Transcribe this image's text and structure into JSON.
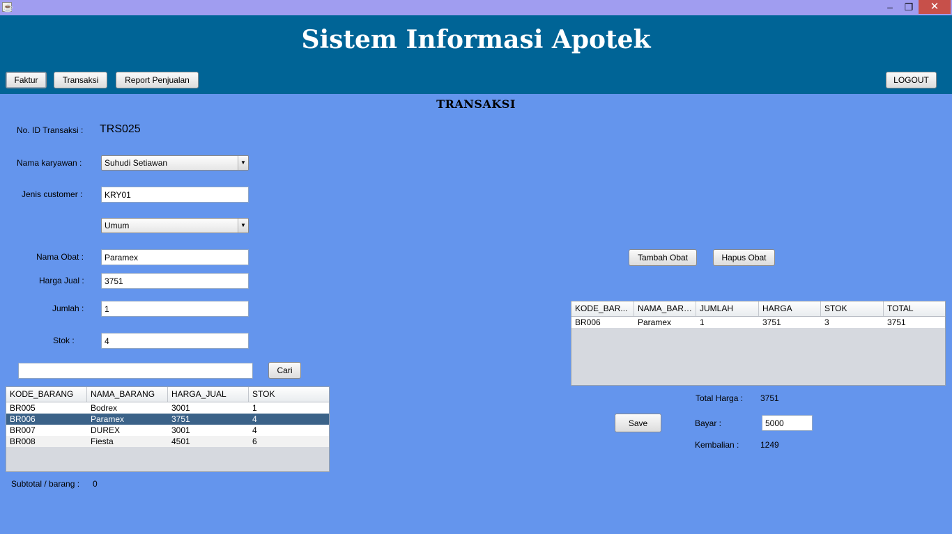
{
  "window": {
    "minimize": "‒",
    "maximize": "❐",
    "close": "✕"
  },
  "app_title": "Sistem Informasi Apotek",
  "nav": {
    "faktur": "Faktur",
    "transaksi": "Transaksi",
    "report": "Report Penjualan",
    "logout": "LOGOUT"
  },
  "section_title": "TRANSAKSI",
  "form": {
    "id_label": "No. ID Transaksi :",
    "id_value": "TRS025",
    "karyawan_label": "Nama karyawan :",
    "karyawan_value": "Suhudi Setiawan",
    "customer_label": "Jenis customer :",
    "customer_value": "KRY01",
    "customer_type_value": "Umum",
    "obat_label": "Nama Obat :",
    "obat_value": "Paramex",
    "harga_label": "Harga Jual :",
    "harga_value": "3751",
    "jumlah_label": "Jumlah :",
    "jumlah_value": "1",
    "stok_label": "Stok :",
    "stok_value": "4",
    "search_value": "",
    "cari_label": "Cari",
    "subtotal_label": "Subtotal / barang :",
    "subtotal_value": "0"
  },
  "stock_table": {
    "columns": [
      "KODE_BARANG",
      "NAMA_BARANG",
      "HARGA_JUAL",
      "STOK"
    ],
    "rows": [
      [
        "BR005",
        "Bodrex",
        "3001",
        "1"
      ],
      [
        "BR006",
        "Paramex",
        "3751",
        "4"
      ],
      [
        "BR007",
        "DUREX",
        "3001",
        "4"
      ],
      [
        "BR008",
        "Fiesta",
        "4501",
        "6"
      ]
    ],
    "selected_row": 1
  },
  "actions": {
    "tambah": "Tambah Obat",
    "hapus": "Hapus Obat",
    "save": "Save"
  },
  "cart_table": {
    "columns": [
      "KODE_BAR...",
      "NAMA_BARA...",
      "JUMLAH",
      "HARGA",
      "STOK",
      "TOTAL"
    ],
    "rows": [
      [
        "BR006",
        "Paramex",
        "1",
        "3751",
        "3",
        "3751"
      ]
    ]
  },
  "payment": {
    "total_label": "Total Harga :",
    "total_value": "3751",
    "bayar_label": "Bayar :",
    "bayar_value": "5000",
    "kembalian_label": "Kembalian :",
    "kembalian_value": "1249"
  },
  "colors": {
    "background": "#6495ed",
    "header": "#006496",
    "titlebar": "#a09df0",
    "selection": "#3b6288"
  }
}
